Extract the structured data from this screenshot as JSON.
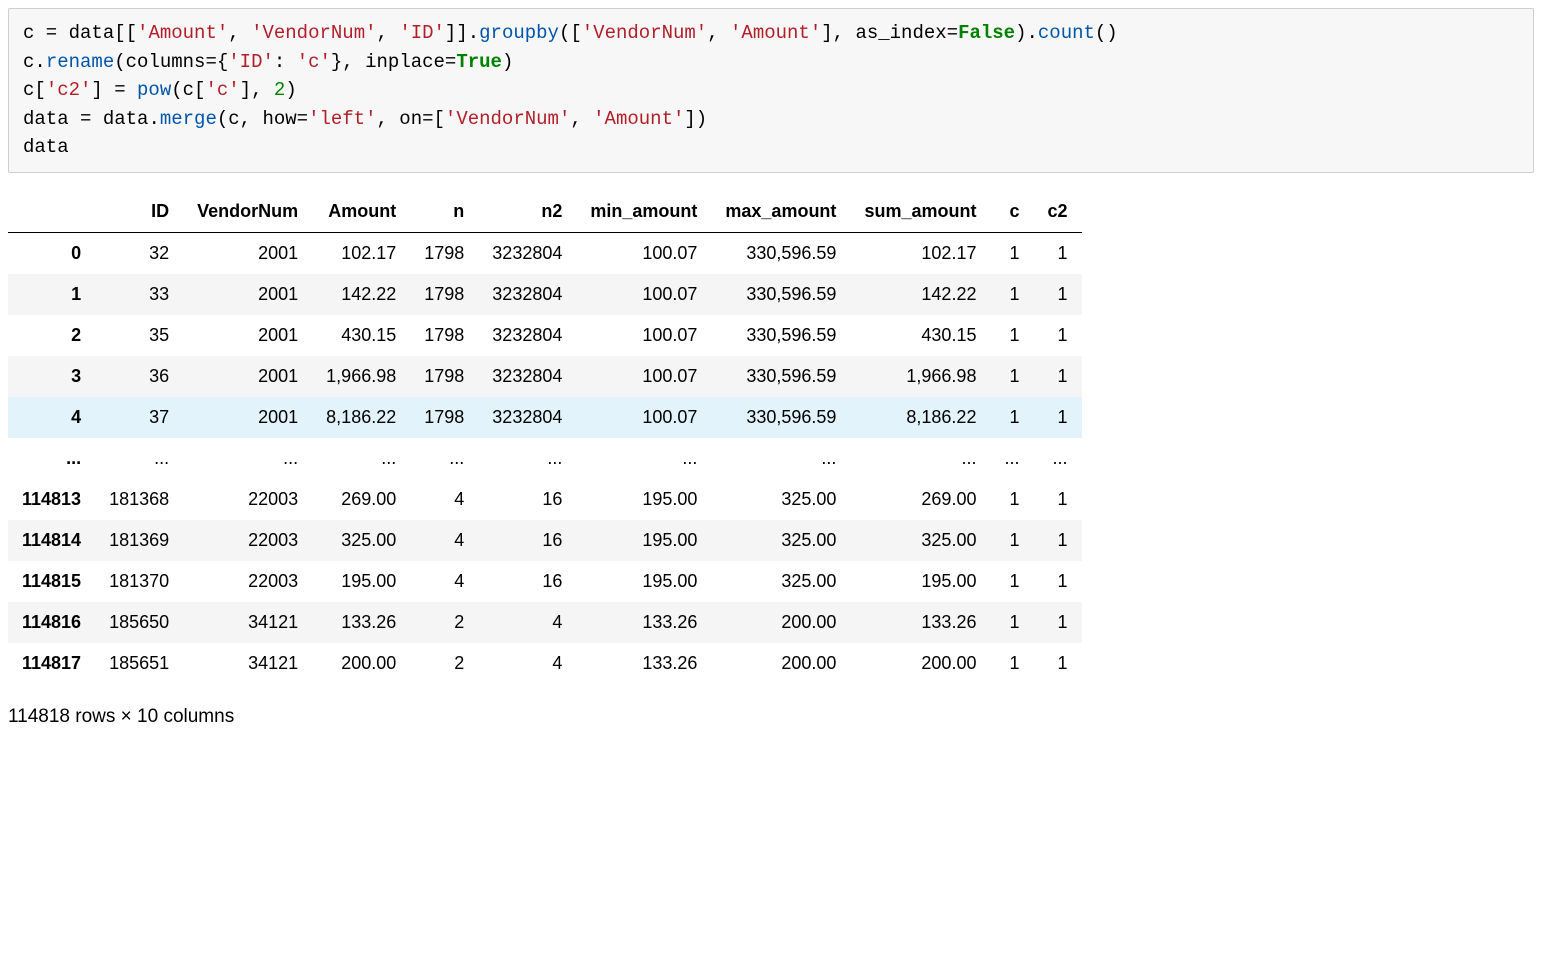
{
  "code": {
    "tokens": [
      [
        [
          "name",
          "c"
        ],
        [
          "op",
          " = "
        ],
        [
          "name",
          "data"
        ],
        [
          "op",
          "[["
        ],
        [
          "str",
          "'Amount'"
        ],
        [
          "op",
          ", "
        ],
        [
          "str",
          "'VendorNum'"
        ],
        [
          "op",
          ", "
        ],
        [
          "str",
          "'ID'"
        ],
        [
          "op",
          "]]"
        ],
        [
          "op",
          "."
        ],
        [
          "fn",
          "groupby"
        ],
        [
          "op",
          "(["
        ],
        [
          "str",
          "'VendorNum'"
        ],
        [
          "op",
          ", "
        ],
        [
          "str",
          "'Amount'"
        ],
        [
          "op",
          "], as_index="
        ],
        [
          "bool",
          "False"
        ],
        [
          "op",
          ")."
        ],
        [
          "fn",
          "count"
        ],
        [
          "op",
          "()"
        ]
      ],
      [
        [
          "name",
          "c"
        ],
        [
          "op",
          "."
        ],
        [
          "fn",
          "rename"
        ],
        [
          "op",
          "(columns={"
        ],
        [
          "str",
          "'ID'"
        ],
        [
          "op",
          ": "
        ],
        [
          "str",
          "'c'"
        ],
        [
          "op",
          "}, inplace="
        ],
        [
          "bool",
          "True"
        ],
        [
          "op",
          ")"
        ]
      ],
      [
        [
          "name",
          "c"
        ],
        [
          "op",
          "["
        ],
        [
          "str",
          "'c2'"
        ],
        [
          "op",
          "] = "
        ],
        [
          "fn",
          "pow"
        ],
        [
          "op",
          "(c["
        ],
        [
          "str",
          "'c'"
        ],
        [
          "op",
          "], "
        ],
        [
          "num",
          "2"
        ],
        [
          "op",
          ")"
        ]
      ],
      [
        [
          "name",
          "data"
        ],
        [
          "op",
          " = "
        ],
        [
          "name",
          "data"
        ],
        [
          "op",
          "."
        ],
        [
          "fn",
          "merge"
        ],
        [
          "op",
          "(c, how="
        ],
        [
          "str",
          "'left'"
        ],
        [
          "op",
          ", on=["
        ],
        [
          "str",
          "'VendorNum'"
        ],
        [
          "op",
          ", "
        ],
        [
          "str",
          "'Amount'"
        ],
        [
          "op",
          "])"
        ]
      ],
      [
        [
          "name",
          "data"
        ]
      ]
    ]
  },
  "dataframe": {
    "columns": [
      "ID",
      "VendorNum",
      "Amount",
      "n",
      "n2",
      "min_amount",
      "max_amount",
      "sum_amount",
      "c",
      "c2"
    ],
    "rows": [
      {
        "idx": "0",
        "cells": [
          "32",
          "2001",
          "102.17",
          "1798",
          "3232804",
          "100.07",
          "330,596.59",
          "102.17",
          "1",
          "1"
        ],
        "cls": "even"
      },
      {
        "idx": "1",
        "cells": [
          "33",
          "2001",
          "142.22",
          "1798",
          "3232804",
          "100.07",
          "330,596.59",
          "142.22",
          "1",
          "1"
        ],
        "cls": "odd"
      },
      {
        "idx": "2",
        "cells": [
          "35",
          "2001",
          "430.15",
          "1798",
          "3232804",
          "100.07",
          "330,596.59",
          "430.15",
          "1",
          "1"
        ],
        "cls": "even"
      },
      {
        "idx": "3",
        "cells": [
          "36",
          "2001",
          "1,966.98",
          "1798",
          "3232804",
          "100.07",
          "330,596.59",
          "1,966.98",
          "1",
          "1"
        ],
        "cls": "odd"
      },
      {
        "idx": "4",
        "cells": [
          "37",
          "2001",
          "8,186.22",
          "1798",
          "3232804",
          "100.07",
          "330,596.59",
          "8,186.22",
          "1",
          "1"
        ],
        "cls": "highlight"
      },
      {
        "idx": "...",
        "cells": [
          "...",
          "...",
          "...",
          "...",
          "...",
          "...",
          "...",
          "...",
          "...",
          "..."
        ],
        "cls": "even"
      },
      {
        "idx": "114813",
        "cells": [
          "181368",
          "22003",
          "269.00",
          "4",
          "16",
          "195.00",
          "325.00",
          "269.00",
          "1",
          "1"
        ],
        "cls": "even"
      },
      {
        "idx": "114814",
        "cells": [
          "181369",
          "22003",
          "325.00",
          "4",
          "16",
          "195.00",
          "325.00",
          "325.00",
          "1",
          "1"
        ],
        "cls": "odd"
      },
      {
        "idx": "114815",
        "cells": [
          "181370",
          "22003",
          "195.00",
          "4",
          "16",
          "195.00",
          "325.00",
          "195.00",
          "1",
          "1"
        ],
        "cls": "even"
      },
      {
        "idx": "114816",
        "cells": [
          "185650",
          "34121",
          "133.26",
          "2",
          "4",
          "133.26",
          "200.00",
          "133.26",
          "1",
          "1"
        ],
        "cls": "odd"
      },
      {
        "idx": "114817",
        "cells": [
          "185651",
          "34121",
          "200.00",
          "2",
          "4",
          "133.26",
          "200.00",
          "200.00",
          "1",
          "1"
        ],
        "cls": "even"
      }
    ],
    "footer": "114818 rows × 10 columns"
  }
}
